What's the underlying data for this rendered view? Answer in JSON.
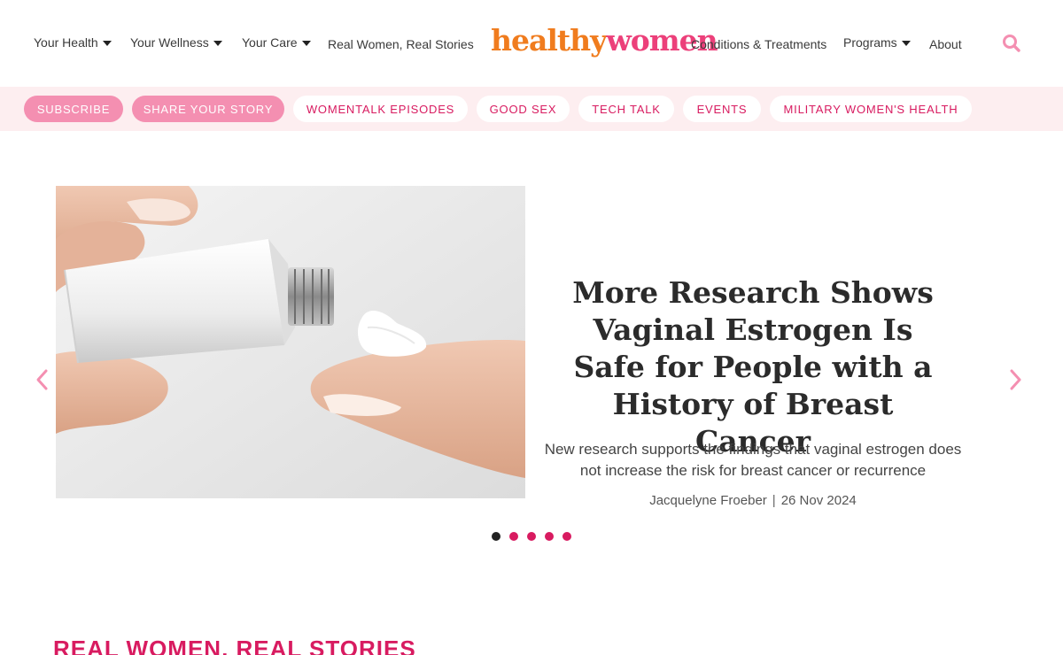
{
  "header": {
    "nav_left": [
      {
        "label": "Your Health",
        "has_dropdown": true
      },
      {
        "label": "Your Wellness",
        "has_dropdown": true
      },
      {
        "label": "Your Care",
        "has_dropdown": true
      },
      {
        "label": "Real Women, Real Stories",
        "has_dropdown": false
      }
    ],
    "logo": {
      "part1": "healthy",
      "part2": "women"
    },
    "nav_right": [
      {
        "label": "Conditions & Treatments",
        "has_dropdown": false
      },
      {
        "label": "Programs",
        "has_dropdown": true
      },
      {
        "label": "About",
        "has_dropdown": false
      }
    ],
    "search_icon": "search-icon"
  },
  "pills": [
    {
      "label": "SUBSCRIBE",
      "style": "solid"
    },
    {
      "label": "SHARE YOUR STORY",
      "style": "solid"
    },
    {
      "label": "WOMENTALK EPISODES",
      "style": "outline"
    },
    {
      "label": "GOOD SEX",
      "style": "outline"
    },
    {
      "label": "TECH TALK",
      "style": "outline"
    },
    {
      "label": "EVENTS",
      "style": "outline"
    },
    {
      "label": "MILITARY WOMEN'S HEALTH",
      "style": "outline"
    }
  ],
  "hero": {
    "title": "More Research Shows Vaginal Estrogen Is Safe for People with a History of Breast Cancer",
    "description": "New research supports the findings that vaginal estrogen does not increase the risk for breast cancer or recurrence",
    "author": "Jacquelyne Froeber",
    "separator": "|",
    "date": "26 Nov 2024",
    "slide_count": 5,
    "active_slide": 1
  },
  "section": {
    "heading": "REAL WOMEN, REAL STORIES"
  },
  "colors": {
    "brand_pink": "#d81b60",
    "logo_orange": "#f07c1e",
    "logo_pink": "#ec407a",
    "pill_solid": "#f48fb1",
    "pill_bar_bg": "#fdeef0",
    "arrow": "#f48fb1"
  }
}
